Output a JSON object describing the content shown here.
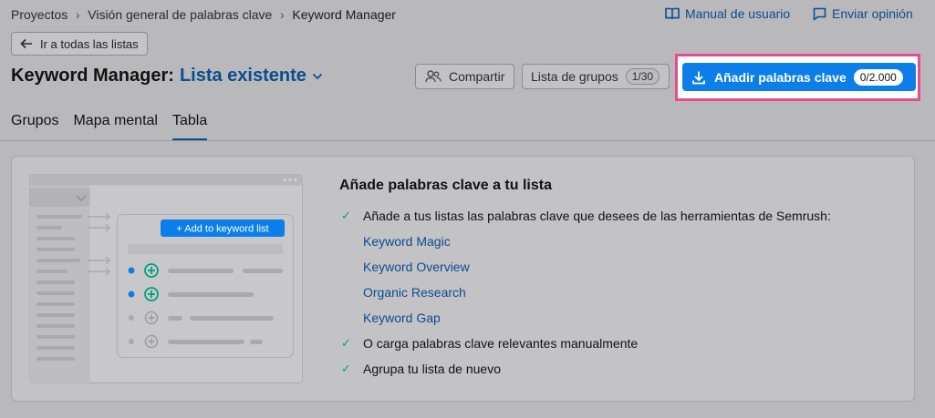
{
  "breadcrumb": {
    "items": [
      "Proyectos",
      "Visión general de palabras clave",
      "Keyword Manager"
    ]
  },
  "top_links": {
    "manual": "Manual de usuario",
    "feedback": "Enviar opinión"
  },
  "back_button": {
    "label": "Ir a todas las listas"
  },
  "header": {
    "title": "Keyword Manager:",
    "list_name": "Lista existente"
  },
  "share_button": {
    "label": "Compartir"
  },
  "groups_button": {
    "label": "Lista de grupos",
    "count": "1/30"
  },
  "add_button": {
    "label": "Añadir palabras clave",
    "count": "0/2.000"
  },
  "tabs": [
    {
      "label": "Grupos"
    },
    {
      "label": "Mapa mental"
    },
    {
      "label": "Tabla"
    }
  ],
  "empty_state": {
    "title": "Añade palabras clave a tu lista",
    "intro": "Añade a tus listas las palabras clave que desees de las herramientas de Semrush:",
    "tools": [
      "Keyword Magic",
      "Keyword Overview",
      "Organic Research",
      "Keyword Gap"
    ],
    "manual": "O carga palabras clave relevantes manualmente",
    "regroup": "Agrupa tu lista de nuevo"
  },
  "illustration": {
    "button_label": "+ Add to keyword list"
  },
  "colors": {
    "accent": "#0b7ee9",
    "link": "#0c4c8f",
    "highlight": "#e64d8f",
    "check": "#009f81"
  }
}
